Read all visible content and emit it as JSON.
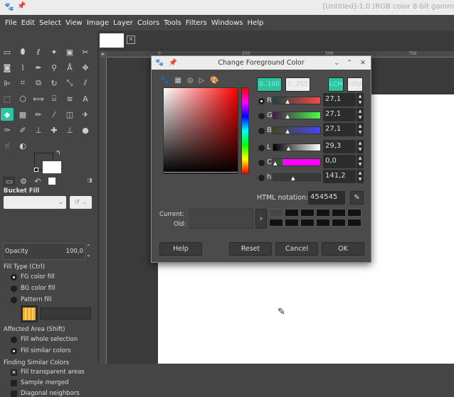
{
  "window": {
    "title": "[Untitled]-1.0 (RGB color 8-bit gamm"
  },
  "menu": [
    "File",
    "Edit",
    "Select",
    "View",
    "Image",
    "Layer",
    "Colors",
    "Tools",
    "Filters",
    "Windows",
    "Help"
  ],
  "tools": [
    "rect-select",
    "ellipse-select",
    "free-select",
    "fuzzy-select",
    "by-color-select",
    "scissors",
    "foreground-select",
    "paths",
    "color-picker",
    "zoom",
    "measure",
    "move",
    "align",
    "crop",
    "unified-transform",
    "rotate",
    "scale",
    "shear",
    "perspective",
    "3d-transform",
    "handle-transform",
    "cage",
    "warp",
    "text",
    "bucket-fill",
    "gradient",
    "pencil",
    "paintbrush",
    "eraser",
    "airbrush",
    "ink",
    "mypaint",
    "clone",
    "heal",
    "perspective-clone",
    "blur",
    "smudge",
    "dodge-burn"
  ],
  "ruler": {
    "top_ticks": [
      "0",
      "250",
      "500",
      "750"
    ],
    "left_ticks": [
      "250",
      "500",
      "750"
    ]
  },
  "tool_options": {
    "tabs": [
      "tool-options",
      "device-status",
      "undo-history",
      "images"
    ],
    "title": "Bucket Fill",
    "mode_value": "",
    "opacity_label": "Opacity",
    "opacity_value": "100,0",
    "fill_type_label": "Fill Type  (Ctrl)",
    "fill_type_options": [
      "FG color fill",
      "BG color fill",
      "Pattern fill"
    ],
    "fill_type_selected": 0,
    "pattern_name": "",
    "affected_label": "Affected Area  (Shift)",
    "affected_options": [
      "Fill whole selection",
      "Fill similar colors"
    ],
    "affected_selected": 1,
    "similar_label": "Finding Similar Colors",
    "checks": [
      {
        "label": "Fill transparent areas",
        "checked": true
      },
      {
        "label": "Sample merged",
        "checked": false
      },
      {
        "label": "Diagonal neighbors",
        "checked": false
      }
    ]
  },
  "dialog": {
    "title": "Change Foreground Color",
    "range_buttons": [
      "0..100",
      "0..255"
    ],
    "model_buttons": [
      "LCH",
      "HSV"
    ],
    "channels": [
      {
        "name": "R",
        "value": "27,1",
        "pos": 0.271,
        "grad": "linear-gradient(90deg,#1b4545,#ff4545)"
      },
      {
        "name": "G",
        "value": "27,1",
        "pos": 0.271,
        "grad": "linear-gradient(90deg,#451b45,#45ff45)"
      },
      {
        "name": "B",
        "value": "27,1",
        "pos": 0.271,
        "grad": "linear-gradient(90deg,#45451b,#4545ff)"
      },
      {
        "name": "L",
        "value": "29,3",
        "pos": 0.293,
        "grad": "linear-gradient(90deg,#000,#fff)"
      },
      {
        "name": "C",
        "value": "0,0",
        "pos": 0.0,
        "grad": "linear-gradient(90deg,#454545 0%,#2e5f2e 20%,#ff00ff 20%,#ff00ff 100%)"
      },
      {
        "name": "h",
        "value": "141,2",
        "pos": 0.392,
        "grad": "#3a3a3a"
      }
    ],
    "selected_channel": "R",
    "html_notation_label": "HTML notation:",
    "html_notation_value": "454545",
    "current_label": "Current:",
    "old_label": "Old:",
    "current_color": "#454545",
    "buttons": {
      "help": "Help",
      "reset": "Reset",
      "cancel": "Cancel",
      "ok": "OK"
    }
  },
  "colors": {
    "accent": "#2ec4a0",
    "foreground": "#454545",
    "background": "#ffffff"
  }
}
